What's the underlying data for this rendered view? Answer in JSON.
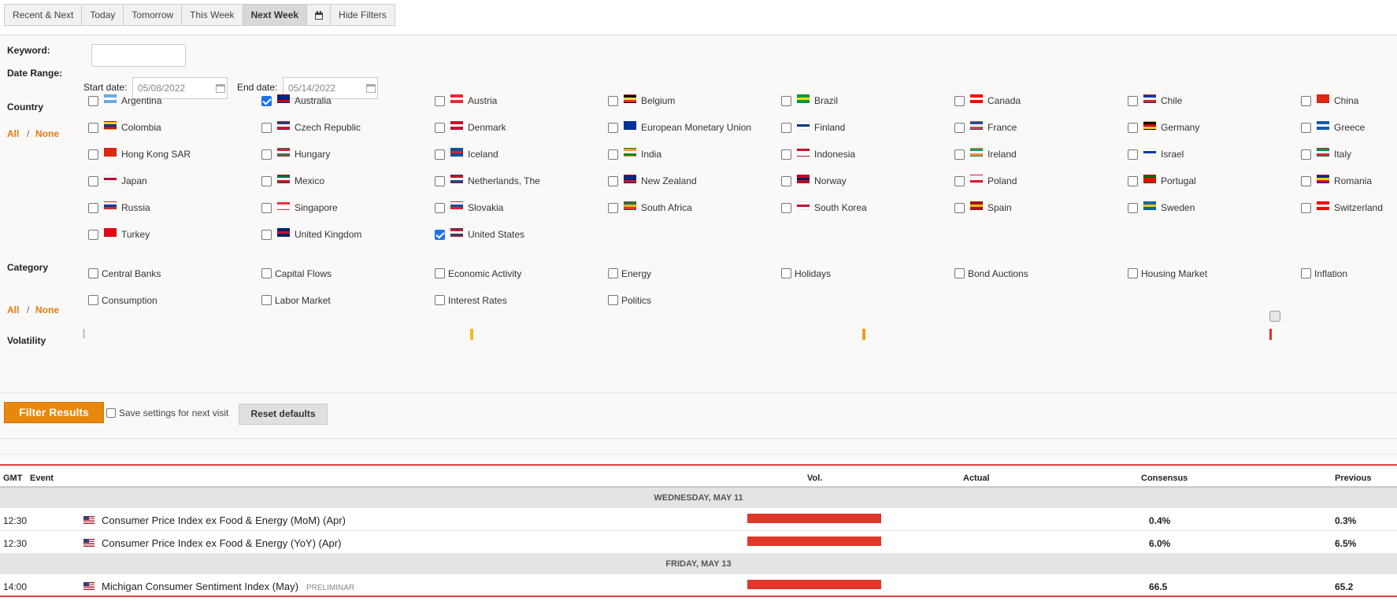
{
  "tabs": [
    "Recent & Next",
    "Today",
    "Tomorrow",
    "This Week",
    "Next Week",
    "Hide Filters"
  ],
  "active_tab": "Next Week",
  "filters": {
    "keyword_label": "Keyword:",
    "keyword_value": "",
    "date_range_label": "Date Range:",
    "start_label": "Start date:",
    "start_value": "05/08/2022",
    "end_label": "End date:",
    "end_value": "05/14/2022",
    "country_label": "Country",
    "all_label": "All",
    "slash": "/",
    "none_label": "None",
    "countries": [
      {
        "name": "Argentina",
        "checked": false,
        "colors": [
          "#74acdf",
          "#ffffff",
          "#74acdf"
        ]
      },
      {
        "name": "Australia",
        "checked": true,
        "colors": [
          "#00247d",
          "#00247d",
          "#cc0000"
        ]
      },
      {
        "name": "Austria",
        "checked": false,
        "colors": [
          "#ed2939",
          "#ffffff",
          "#ed2939"
        ]
      },
      {
        "name": "Belgium",
        "checked": false,
        "colors": [
          "#000000",
          "#fae042",
          "#ed2939"
        ]
      },
      {
        "name": "Brazil",
        "checked": false,
        "colors": [
          "#009c3b",
          "#ffdf00",
          "#009c3b"
        ]
      },
      {
        "name": "Canada",
        "checked": false,
        "colors": [
          "#ff0000",
          "#ffffff",
          "#ff0000"
        ]
      },
      {
        "name": "Chile",
        "checked": false,
        "colors": [
          "#0039a6",
          "#ffffff",
          "#d52b1e"
        ]
      },
      {
        "name": "China",
        "checked": false,
        "colors": [
          "#de2910",
          "#de2910",
          "#de2910"
        ]
      },
      {
        "name": "Colombia",
        "checked": false,
        "colors": [
          "#fcd116",
          "#003893",
          "#ce1126"
        ]
      },
      {
        "name": "Czech Republic",
        "checked": false,
        "colors": [
          "#11457e",
          "#ffffff",
          "#d7141a"
        ]
      },
      {
        "name": "Denmark",
        "checked": false,
        "colors": [
          "#c8102e",
          "#ffffff",
          "#c8102e"
        ]
      },
      {
        "name": "European Monetary Union",
        "checked": false,
        "colors": [
          "#003399",
          "#003399",
          "#003399"
        ]
      },
      {
        "name": "Finland",
        "checked": false,
        "colors": [
          "#ffffff",
          "#003580",
          "#ffffff"
        ]
      },
      {
        "name": "France",
        "checked": false,
        "colors": [
          "#0055a4",
          "#ffffff",
          "#ef4135"
        ]
      },
      {
        "name": "Germany",
        "checked": false,
        "colors": [
          "#000000",
          "#dd0000",
          "#ffce00"
        ]
      },
      {
        "name": "Greece",
        "checked": false,
        "colors": [
          "#0d5eaf",
          "#ffffff",
          "#0d5eaf"
        ]
      },
      {
        "name": "Hong Kong SAR",
        "checked": false,
        "colors": [
          "#de2910",
          "#de2910",
          "#de2910"
        ]
      },
      {
        "name": "Hungary",
        "checked": false,
        "colors": [
          "#cd2a3e",
          "#ffffff",
          "#436f4d"
        ]
      },
      {
        "name": "Iceland",
        "checked": false,
        "colors": [
          "#02529c",
          "#dc1e35",
          "#02529c"
        ]
      },
      {
        "name": "India",
        "checked": false,
        "colors": [
          "#ff9933",
          "#ffffff",
          "#138808"
        ]
      },
      {
        "name": "Indonesia",
        "checked": false,
        "colors": [
          "#ce1126",
          "#ffffff",
          "#ffffff"
        ]
      },
      {
        "name": "Ireland",
        "checked": false,
        "colors": [
          "#169b62",
          "#ffffff",
          "#ff883e"
        ]
      },
      {
        "name": "Israel",
        "checked": false,
        "colors": [
          "#ffffff",
          "#0038b8",
          "#ffffff"
        ]
      },
      {
        "name": "Italy",
        "checked": false,
        "colors": [
          "#009246",
          "#ffffff",
          "#ce2b37"
        ]
      },
      {
        "name": "Japan",
        "checked": false,
        "colors": [
          "#ffffff",
          "#bc002d",
          "#ffffff"
        ]
      },
      {
        "name": "Mexico",
        "checked": false,
        "colors": [
          "#006847",
          "#ffffff",
          "#ce1126"
        ]
      },
      {
        "name": "Netherlands, The",
        "checked": false,
        "colors": [
          "#ae1c28",
          "#ffffff",
          "#21468b"
        ]
      },
      {
        "name": "New Zealand",
        "checked": false,
        "colors": [
          "#00247d",
          "#00247d",
          "#cc142b"
        ]
      },
      {
        "name": "Norway",
        "checked": false,
        "colors": [
          "#ba0c2f",
          "#00205b",
          "#ba0c2f"
        ]
      },
      {
        "name": "Poland",
        "checked": false,
        "colors": [
          "#ffffff",
          "#ffffff",
          "#dc143c"
        ]
      },
      {
        "name": "Portugal",
        "checked": false,
        "colors": [
          "#006600",
          "#ff0000",
          "#ff0000"
        ]
      },
      {
        "name": "Romania",
        "checked": false,
        "colors": [
          "#002b7f",
          "#fcd116",
          "#ce1126"
        ]
      },
      {
        "name": "Russia",
        "checked": false,
        "colors": [
          "#ffffff",
          "#0039a6",
          "#d52b1e"
        ]
      },
      {
        "name": "Singapore",
        "checked": false,
        "colors": [
          "#ef3340",
          "#ffffff",
          "#ffffff"
        ]
      },
      {
        "name": "Slovakia",
        "checked": false,
        "colors": [
          "#ffffff",
          "#0b4ea2",
          "#ee1c25"
        ]
      },
      {
        "name": "South Africa",
        "checked": false,
        "colors": [
          "#007a4d",
          "#ffb612",
          "#de3831"
        ]
      },
      {
        "name": "South Korea",
        "checked": false,
        "colors": [
          "#ffffff",
          "#c60c30",
          "#ffffff"
        ]
      },
      {
        "name": "Spain",
        "checked": false,
        "colors": [
          "#aa151b",
          "#f1bf00",
          "#aa151b"
        ]
      },
      {
        "name": "Sweden",
        "checked": false,
        "colors": [
          "#006aa7",
          "#fecc00",
          "#006aa7"
        ]
      },
      {
        "name": "Switzerland",
        "checked": false,
        "colors": [
          "#ff0000",
          "#ffffff",
          "#ff0000"
        ]
      },
      {
        "name": "Turkey",
        "checked": false,
        "colors": [
          "#e30a17",
          "#e30a17",
          "#e30a17"
        ]
      },
      {
        "name": "United Kingdom",
        "checked": false,
        "colors": [
          "#012169",
          "#c8102e",
          "#012169"
        ]
      },
      {
        "name": "United States",
        "checked": true,
        "colors": [
          "#b22234",
          "#ffffff",
          "#3c3b6e"
        ]
      }
    ],
    "category_label": "Category",
    "categories": [
      {
        "name": "Central Banks",
        "checked": false
      },
      {
        "name": "Capital Flows",
        "checked": false
      },
      {
        "name": "Economic Activity",
        "checked": false
      },
      {
        "name": "Energy",
        "checked": false
      },
      {
        "name": "Holidays",
        "checked": false
      },
      {
        "name": "Bond Auctions",
        "checked": false
      },
      {
        "name": "Housing Market",
        "checked": false
      },
      {
        "name": "Inflation",
        "checked": false
      },
      {
        "name": "Consumption",
        "checked": false
      },
      {
        "name": "Labor Market",
        "checked": false
      },
      {
        "name": "Interest Rates",
        "checked": false
      },
      {
        "name": "Politics",
        "checked": false
      }
    ],
    "volatility_label": "Volatility",
    "volatility_colors": [
      "#cccccc",
      "#f5b921",
      "#f09a1a",
      "#e0302a"
    ],
    "filter_button": "Filter Results",
    "save_label": "Save settings for next visit",
    "reset_button": "Reset defaults"
  },
  "colors": {
    "accent": "#e8870e",
    "high_volatility": "#e0372b",
    "checkbox_checked": "#1a73e8"
  },
  "table": {
    "headers": {
      "gmt": "GMT",
      "event": "Event",
      "vol": "Vol.",
      "actual": "Actual",
      "consensus": "Consensus",
      "previous": "Previous"
    },
    "groups": [
      {
        "day": "WEDNESDAY, MAY 11",
        "rows": [
          {
            "time": "12:30",
            "event": "Consumer Price Index ex Food & Energy (MoM) (Apr)",
            "tag": "",
            "actual": "",
            "consensus": "0.4%",
            "previous": "0.3%",
            "volatility": "high"
          },
          {
            "time": "12:30",
            "event": "Consumer Price Index ex Food & Energy (YoY) (Apr)",
            "tag": "",
            "actual": "",
            "consensus": "6.0%",
            "previous": "6.5%",
            "volatility": "high"
          }
        ]
      },
      {
        "day": "FRIDAY, MAY 13",
        "rows": [
          {
            "time": "14:00",
            "event": "Michigan Consumer Sentiment Index (May)",
            "tag": "PRELIMINAR",
            "actual": "",
            "consensus": "66.5",
            "previous": "65.2",
            "volatility": "high"
          }
        ]
      }
    ]
  }
}
